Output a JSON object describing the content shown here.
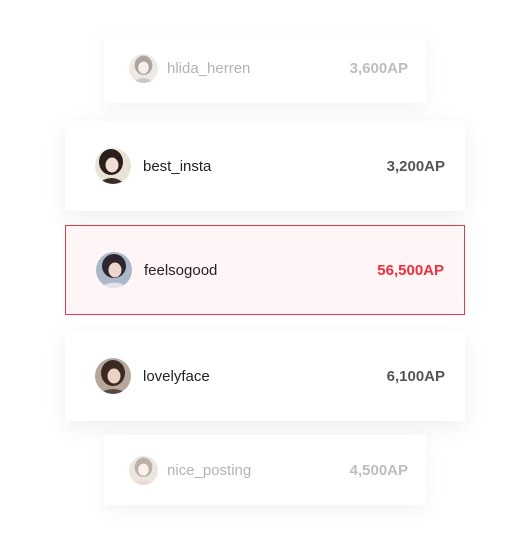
{
  "colors": {
    "accent": "#ee2f3f",
    "highlight_border": "#e23a47",
    "highlight_bg": "#fff5f6"
  },
  "leaderboard": [
    {
      "username": "hlida_herren",
      "points": "3,600AP",
      "avatar": "user-avatar-photo",
      "state": "faded"
    },
    {
      "username": "best_insta",
      "points": "3,200AP",
      "avatar": "user-avatar-photo",
      "state": "normal"
    },
    {
      "username": "feelsogood",
      "points": "56,500AP",
      "avatar": "user-avatar-photo",
      "state": "selected"
    },
    {
      "username": "lovelyface",
      "points": "6,100AP",
      "avatar": "user-avatar-photo",
      "state": "normal"
    },
    {
      "username": "nice_posting",
      "points": "4,500AP",
      "avatar": "user-avatar-photo",
      "state": "faded"
    }
  ]
}
